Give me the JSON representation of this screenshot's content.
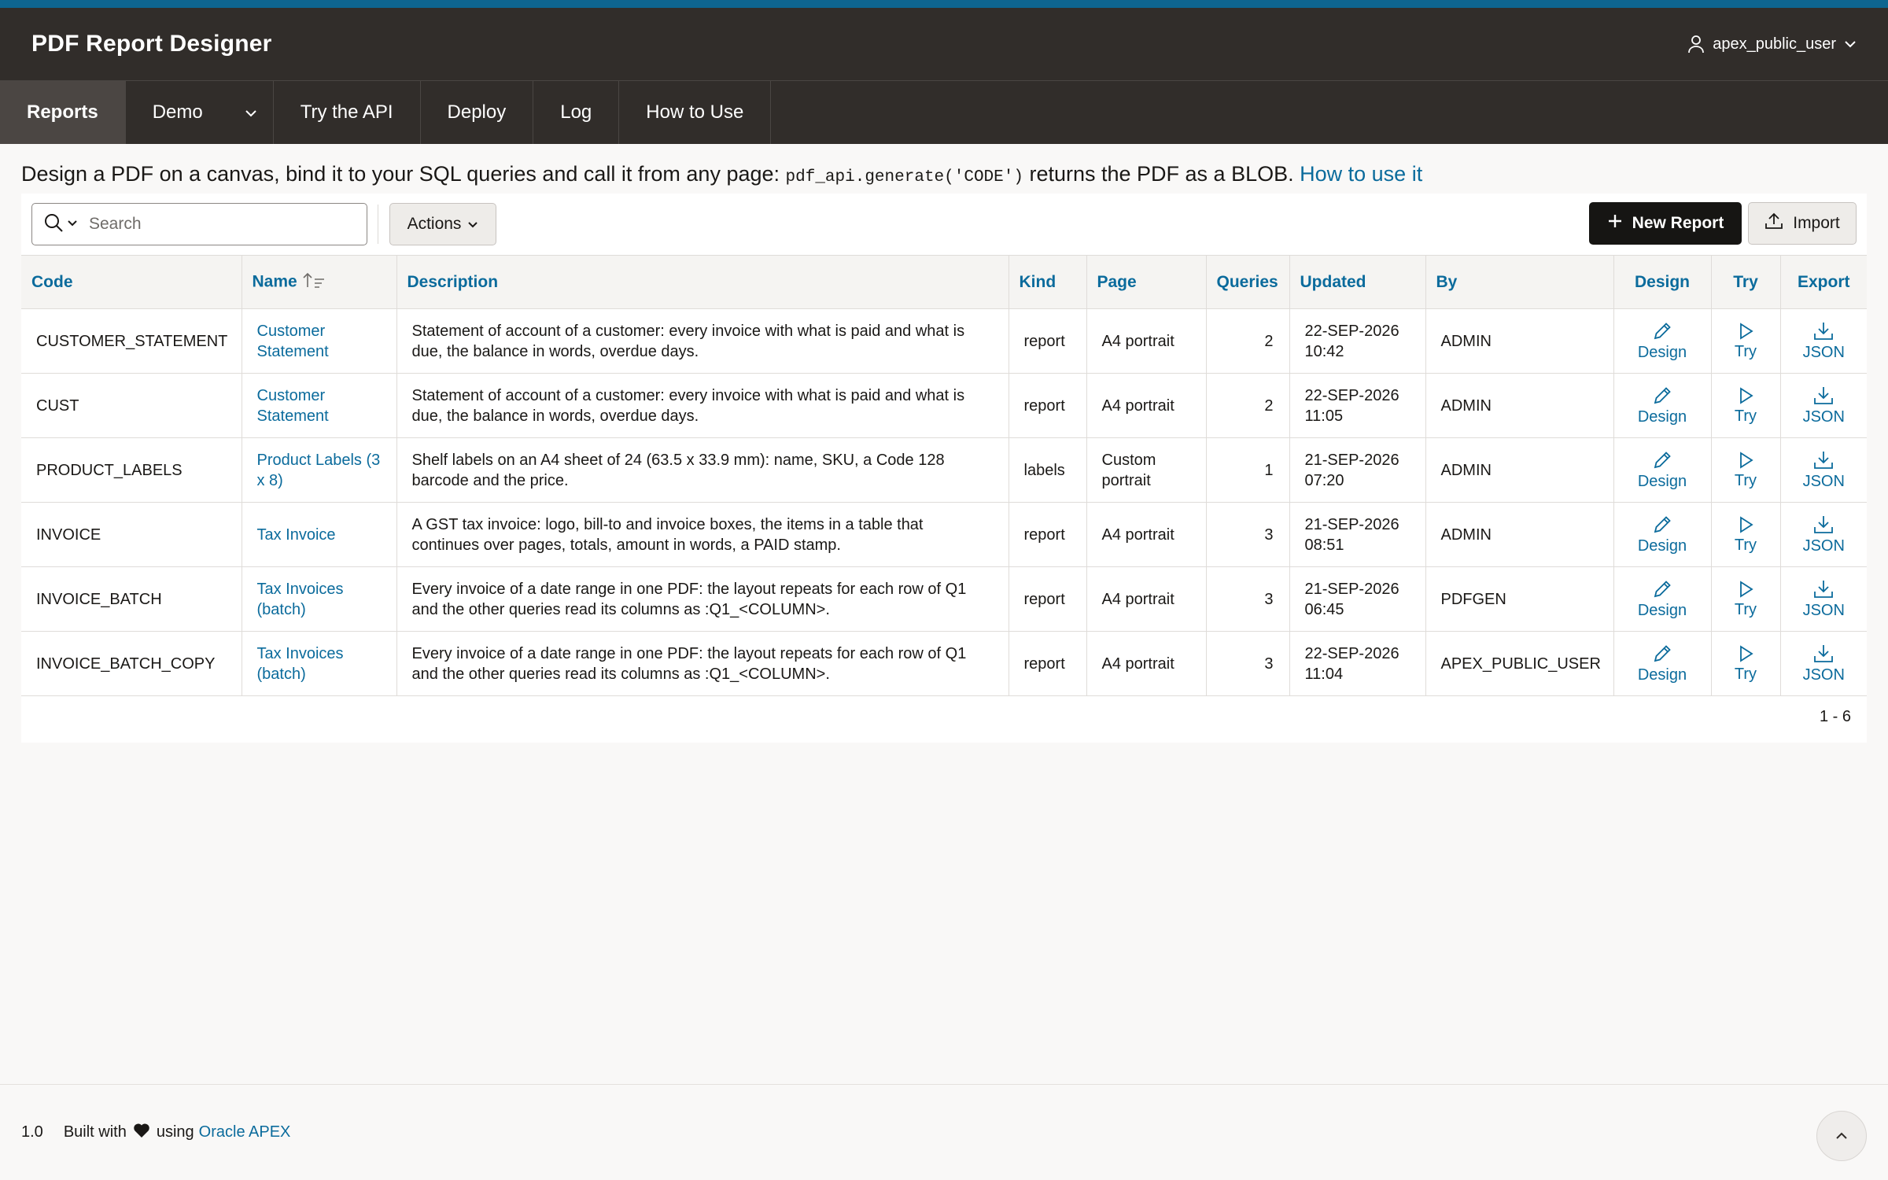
{
  "app": {
    "title": "PDF Report Designer",
    "user": "apex_public_user"
  },
  "nav": {
    "items": [
      {
        "label": "Reports",
        "active": true
      },
      {
        "label": "Demo",
        "has_menu": true
      },
      {
        "label": "Try the API"
      },
      {
        "label": "Deploy"
      },
      {
        "label": "Log"
      },
      {
        "label": "How to Use"
      }
    ]
  },
  "intro": {
    "text_before": "Design a PDF on a canvas, bind it to your SQL queries and call it from any page: ",
    "code": "pdf_api.generate('CODE')",
    "text_after": " returns the PDF as a BLOB. ",
    "link": "How to use it"
  },
  "toolbar": {
    "search_placeholder": "Search",
    "actions_label": "Actions",
    "new_report_label": "New Report",
    "import_label": "Import"
  },
  "table": {
    "columns": [
      "Code",
      "Name",
      "Description",
      "Kind",
      "Page",
      "Queries",
      "Updated",
      "By",
      "Design",
      "Try",
      "Export"
    ],
    "sorted_column": "Name",
    "rows": [
      {
        "code": "CUSTOMER_STATEMENT",
        "name": "Customer Statement",
        "description": "Statement of account of a customer: every invoice with what is paid and what is due, the balance in words, overdue days.",
        "kind": "report",
        "page": "A4 portrait",
        "queries": "2",
        "updated": "22-SEP-2026 10:42",
        "by": "ADMIN",
        "design": "Design",
        "try": "Try",
        "export": "JSON"
      },
      {
        "code": "CUST",
        "name": "Customer Statement",
        "description": "Statement of account of a customer: every invoice with what is paid and what is due, the balance in words, overdue days.",
        "kind": "report",
        "page": "A4 portrait",
        "queries": "2",
        "updated": "22-SEP-2026 11:05",
        "by": "ADMIN",
        "design": "Design",
        "try": "Try",
        "export": "JSON"
      },
      {
        "code": "PRODUCT_LABELS",
        "name": "Product Labels (3 x 8)",
        "description": "Shelf labels on an A4 sheet of 24 (63.5 x 33.9 mm): name, SKU, a Code 128 barcode and the price.",
        "kind": "labels",
        "page": "Custom portrait",
        "queries": "1",
        "updated": "21-SEP-2026 07:20",
        "by": "ADMIN",
        "design": "Design",
        "try": "Try",
        "export": "JSON"
      },
      {
        "code": "INVOICE",
        "name": "Tax Invoice",
        "description": "A GST tax invoice: logo, bill-to and invoice boxes, the items in a table that continues over pages, totals, amount in words, a PAID stamp.",
        "kind": "report",
        "page": "A4 portrait",
        "queries": "3",
        "updated": "21-SEP-2026 08:51",
        "by": "ADMIN",
        "design": "Design",
        "try": "Try",
        "export": "JSON"
      },
      {
        "code": "INVOICE_BATCH",
        "name": "Tax Invoices (batch)",
        "description": "Every invoice of a date range in one PDF: the layout repeats for each row of Q1 and the other queries read its columns as :Q1_<COLUMN>.",
        "kind": "report",
        "page": "A4 portrait",
        "queries": "3",
        "updated": "21-SEP-2026 06:45",
        "by": "PDFGEN",
        "design": "Design",
        "try": "Try",
        "export": "JSON"
      },
      {
        "code": "INVOICE_BATCH_COPY",
        "name": "Tax Invoices (batch)",
        "description": "Every invoice of a date range in one PDF: the layout repeats for each row of Q1 and the other queries read its columns as :Q1_<COLUMN>.",
        "kind": "report",
        "page": "A4 portrait",
        "queries": "3",
        "updated": "22-SEP-2026 11:04",
        "by": "APEX_PUBLIC_USER",
        "design": "Design",
        "try": "Try",
        "export": "JSON"
      }
    ],
    "pagination": "1 - 6"
  },
  "footer": {
    "version": "1.0",
    "built_with": "Built with",
    "using": "using",
    "link": "Oracle APEX"
  },
  "colors": {
    "accent": "#0b6b9c",
    "header_bg": "#312d2a",
    "top_stripe": "#0e6590",
    "primary_button": "#161513"
  }
}
